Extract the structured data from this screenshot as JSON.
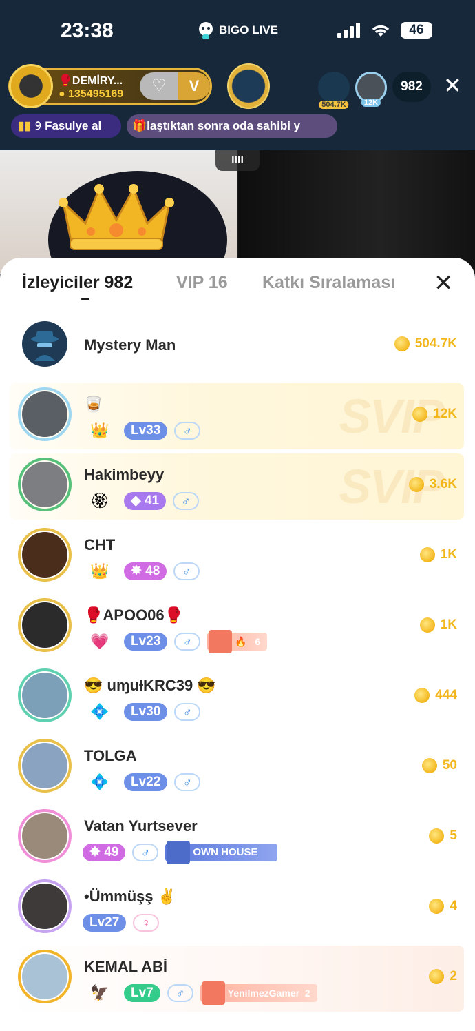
{
  "status_bar": {
    "time": "23:38",
    "brand": "BIGO LIVE",
    "battery": "46"
  },
  "live": {
    "host": {
      "name": "🥊DEMİRY...",
      "coins": "135495169",
      "heart_badge": "♡",
      "v_badge": "V"
    },
    "top_viewers": [
      {
        "tag": "504.7K"
      },
      {
        "tag": "12K"
      }
    ],
    "viewer_count": "982",
    "notices": [
      "𝟿 Fasulye al",
      "laştıktan sonra oda sahibi y"
    ],
    "video_handle": "IIII"
  },
  "sheet": {
    "tabs": [
      {
        "label": "İzleyiciler 982"
      },
      {
        "label": "VIP 16"
      },
      {
        "label": "Katkı Sıralaması"
      }
    ],
    "watermark": "SVIP",
    "viewers": [
      {
        "name": "Mystery Man",
        "coins": "504.7K"
      },
      {
        "name": "🥃",
        "level": "Lv33",
        "gender": "♂",
        "coins": "12K"
      },
      {
        "name": "Hakimbeyy",
        "level": "◆ 41",
        "gender": "♂",
        "coins": "3.6K"
      },
      {
        "name": "CHT",
        "level": "✸ 48",
        "gender": "♂",
        "coins": "1K"
      },
      {
        "name": "🥊APOO06🥊",
        "level": "Lv23",
        "gender": "♂",
        "fan_label": "🔥",
        "fan_count": "6",
        "coins": "1K"
      },
      {
        "name": "😎 uɱuƚKRC39 😎",
        "level": "Lv30",
        "gender": "♂",
        "coins": "444"
      },
      {
        "name": "TOLGA",
        "level": "Lv22",
        "gender": "♂",
        "coins": "50"
      },
      {
        "name": "Vatan Yurtsever",
        "level": "✸ 49",
        "gender": "♂",
        "house_label": "OWN HOUSE",
        "coins": "5"
      },
      {
        "name": "•Ümmüşş ✌️",
        "level": "Lv27",
        "gender": "♀",
        "coins": "4"
      },
      {
        "name": "KEMAL ABİ",
        "level": "Lv7",
        "gender": "♂",
        "fan_label": "YenilmezGamer",
        "fan_count": "2",
        "coins": "2"
      }
    ]
  }
}
